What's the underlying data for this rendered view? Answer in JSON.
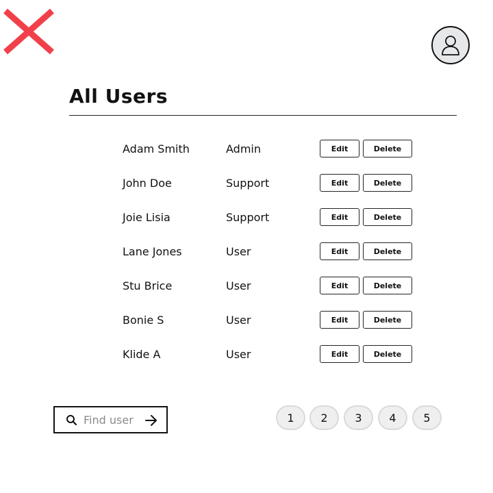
{
  "header": {
    "title": "All Users",
    "close_icon": "close-x-icon",
    "close_color": "#f2404b",
    "avatar_icon": "user-icon"
  },
  "users": [
    {
      "name": "Adam Smith",
      "role": "Admin"
    },
    {
      "name": "John Doe",
      "role": "Support"
    },
    {
      "name": "Joie Lisia",
      "role": "Support"
    },
    {
      "name": "Lane Jones",
      "role": "User"
    },
    {
      "name": "Stu Brice",
      "role": "User"
    },
    {
      "name": "Bonie S",
      "role": "User"
    },
    {
      "name": "Klide A",
      "role": "User"
    }
  ],
  "actions": {
    "edit_label": "Edit",
    "delete_label": "Delete"
  },
  "search": {
    "placeholder": "Find user",
    "value": "",
    "icon": "search-icon",
    "submit_icon": "arrow-right-icon"
  },
  "pagination": {
    "pages": [
      "1",
      "2",
      "3",
      "4",
      "5"
    ]
  }
}
